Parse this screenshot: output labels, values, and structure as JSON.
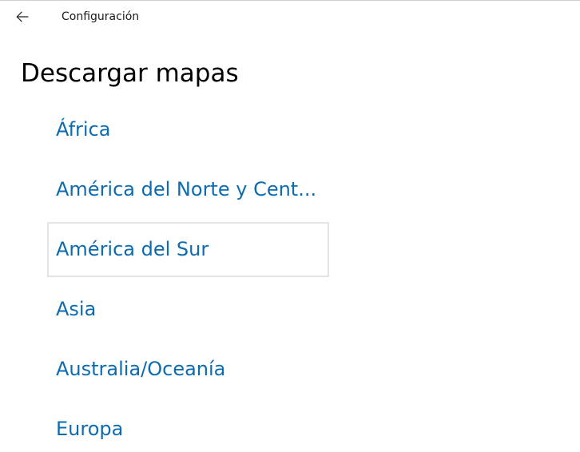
{
  "window": {
    "app_title": "Configuración"
  },
  "page": {
    "title": "Descargar mapas"
  },
  "regions": [
    {
      "label": "África"
    },
    {
      "label": "América del Norte y Cent..."
    },
    {
      "label": "América del Sur"
    },
    {
      "label": "Asia"
    },
    {
      "label": "Australia/Oceanía"
    },
    {
      "label": "Europa"
    }
  ],
  "colors": {
    "link": "#0d6bb0",
    "focus_border": "#e4e4e4",
    "background": "#ffffff"
  },
  "icons": {
    "back": "arrow-left-icon"
  }
}
